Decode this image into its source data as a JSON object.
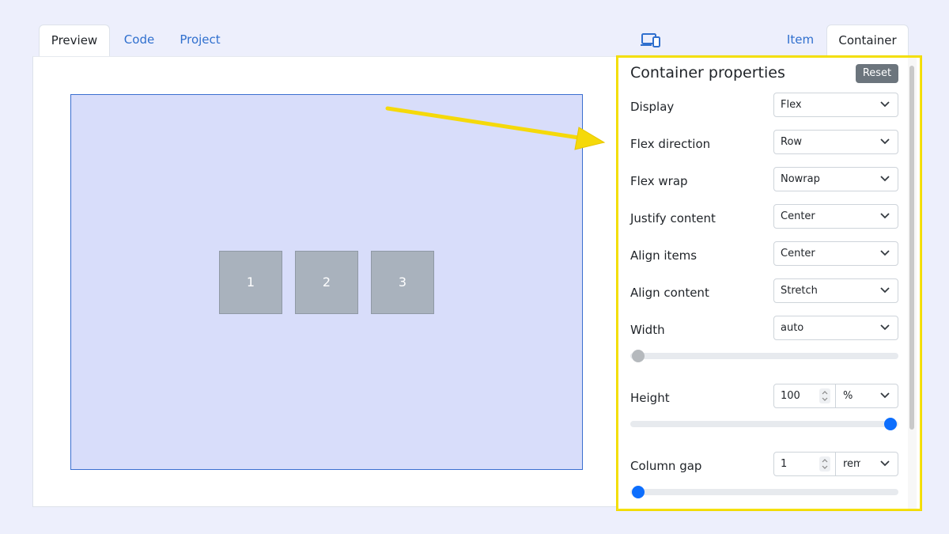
{
  "tabs_left": [
    {
      "label": "Preview",
      "active": true
    },
    {
      "label": "Code",
      "active": false
    },
    {
      "label": "Project",
      "active": false
    }
  ],
  "tabs_right": [
    {
      "label": "Item",
      "active": false
    },
    {
      "label": "Container",
      "active": true
    }
  ],
  "device_icon": "responsive-devices-icon",
  "preview": {
    "items": [
      "1",
      "2",
      "3"
    ]
  },
  "container_panel": {
    "title": "Container properties",
    "reset_label": "Reset",
    "display": {
      "label": "Display",
      "value": "Flex"
    },
    "flex_direction": {
      "label": "Flex direction",
      "value": "Row"
    },
    "flex_wrap": {
      "label": "Flex wrap",
      "value": "Nowrap"
    },
    "justify_content": {
      "label": "Justify content",
      "value": "Center"
    },
    "align_items": {
      "label": "Align items",
      "value": "Center"
    },
    "align_content": {
      "label": "Align content",
      "value": "Stretch"
    },
    "width": {
      "label": "Width",
      "value": "auto",
      "slider_fraction": 0.0
    },
    "height": {
      "label": "Height",
      "value": "100",
      "unit": "%",
      "slider_fraction": 1.0
    },
    "column_gap": {
      "label": "Column gap",
      "value": "1",
      "unit": "rem",
      "slider_fraction": 0.0
    }
  },
  "colors": {
    "accent": "#0d6efd",
    "highlight": "#f5e10f",
    "preview_bg": "#d8ddfa",
    "item_bg": "#a9b2bd"
  }
}
